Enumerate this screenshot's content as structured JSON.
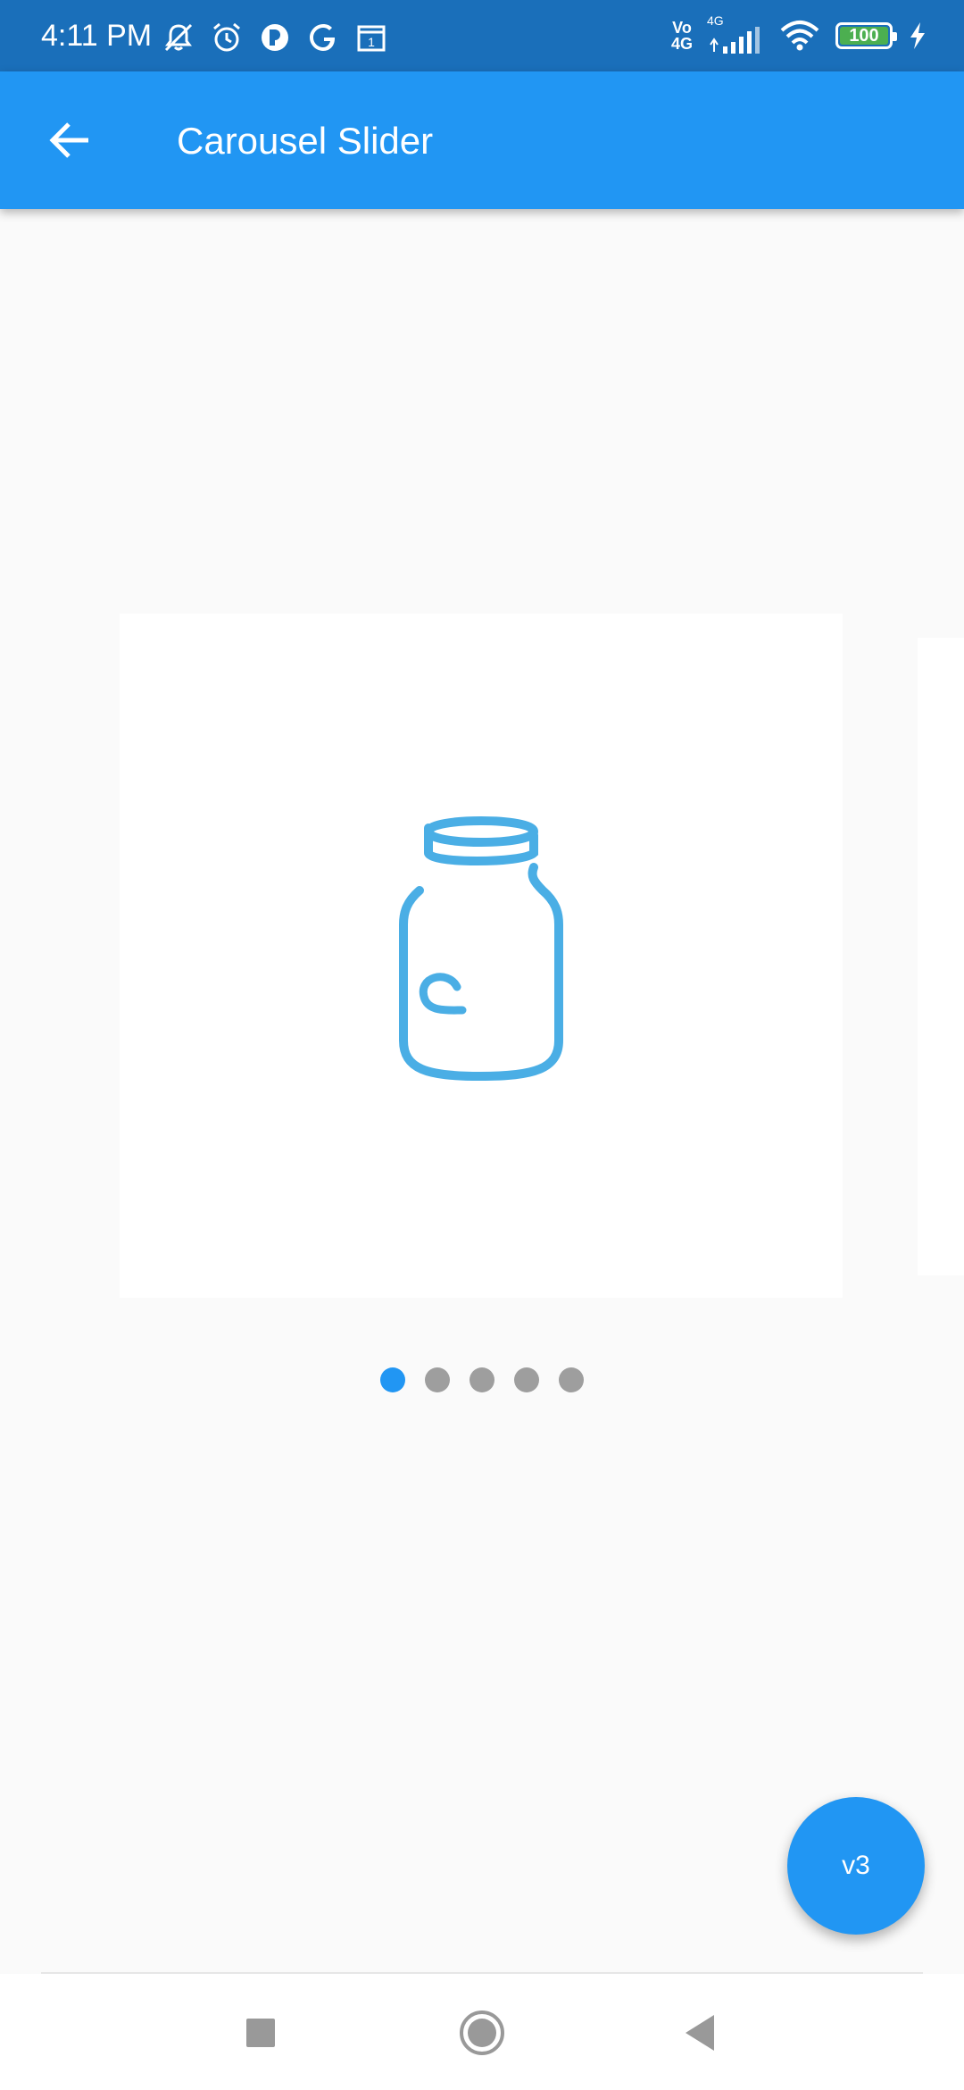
{
  "status_bar": {
    "time": "4:11 PM",
    "network_label_1": "Vo",
    "network_label_2": "4G",
    "network_label_3": "4G",
    "battery_level": "100",
    "icons": [
      "mute-icon",
      "alarm-icon",
      "app-notification-icon",
      "google-icon",
      "calendar-icon",
      "signal-icon",
      "wifi-icon",
      "battery-icon",
      "charging-icon"
    ]
  },
  "app_bar": {
    "title": "Carousel Slider",
    "back_icon": "arrow-back-icon"
  },
  "carousel": {
    "slide_icon": "jar-icon",
    "slide_count": 5,
    "active_index": 0,
    "accent_color": "#2196f3",
    "dot_inactive_color": "#9e9e9e"
  },
  "fab": {
    "label": "v3"
  },
  "colors": {
    "status_bar": "#1a6fba",
    "app_bar": "#2196f3",
    "background": "#fafafa",
    "jar_stroke": "#4aaee5"
  },
  "nav_bar": {
    "icons": [
      "recents-icon",
      "home-icon",
      "back-icon"
    ]
  }
}
